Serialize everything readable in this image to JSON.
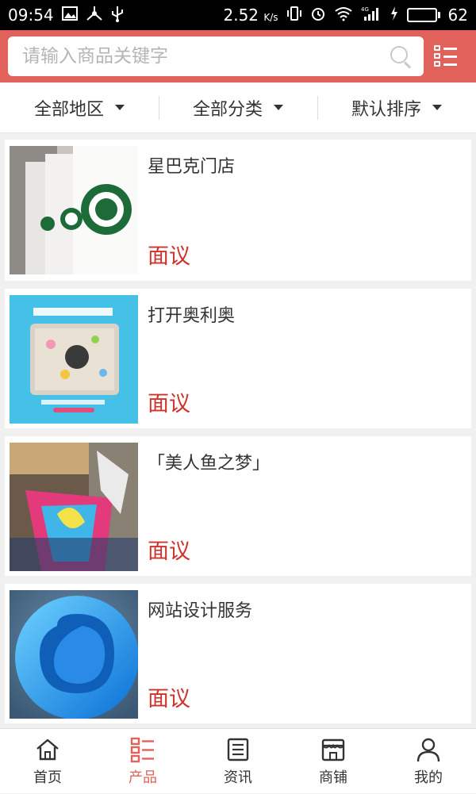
{
  "status_bar": {
    "time": "09:54",
    "speed": "2.52",
    "speed_unit": "K/s",
    "network": "4G",
    "battery": "62",
    "battery_level": 0.62
  },
  "search": {
    "placeholder": "请输入商品关键字",
    "value": ""
  },
  "filters": [
    {
      "label": "全部地区"
    },
    {
      "label": "全部分类"
    },
    {
      "label": "默认排序"
    }
  ],
  "products": [
    {
      "name": "星巴克门店",
      "price": "面议",
      "image": "starbucks-cups"
    },
    {
      "name": "打开奥利奥",
      "price": "面议",
      "image": "oreo-package"
    },
    {
      "name": "「美人鱼之梦」",
      "price": "面议",
      "image": "mall-sculpture"
    },
    {
      "name": "网站设计服务",
      "price": "面议",
      "image": "blue-app-logo"
    }
  ],
  "nav": [
    {
      "label": "首页",
      "icon": "home-icon",
      "active": false
    },
    {
      "label": "产品",
      "icon": "product-list-icon",
      "active": true
    },
    {
      "label": "资讯",
      "icon": "news-icon",
      "active": false
    },
    {
      "label": "商铺",
      "icon": "shop-icon",
      "active": false
    },
    {
      "label": "我的",
      "icon": "user-icon",
      "active": false
    }
  ],
  "colors": {
    "accent": "#e0625a",
    "price": "#d0322c",
    "battery": "#3fd24a"
  }
}
